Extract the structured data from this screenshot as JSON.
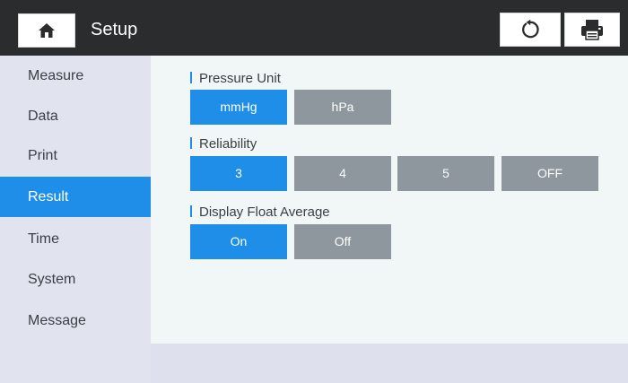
{
  "header": {
    "title": "Setup"
  },
  "sidebar": {
    "items": [
      {
        "label": "Measure"
      },
      {
        "label": "Data"
      },
      {
        "label": "Print"
      },
      {
        "label": "Result"
      },
      {
        "label": "Time"
      },
      {
        "label": "System"
      },
      {
        "label": "Message"
      }
    ],
    "active": "Result"
  },
  "settings": {
    "pressure_unit": {
      "title": "Pressure Unit",
      "options": [
        "mmHg",
        "hPa"
      ],
      "selected": "mmHg"
    },
    "reliability": {
      "title": "Reliability",
      "options": [
        "3",
        "4",
        "5",
        "OFF"
      ],
      "selected": "3"
    },
    "display_float_average": {
      "title": "Display Float Average",
      "options": [
        "On",
        "Off"
      ],
      "selected": "On"
    }
  },
  "colors": {
    "accent": "#1e8ee8",
    "unselected": "#8d979d",
    "topbar": "#2b2c2d",
    "sidebar": "#e1e3ef",
    "panel": "#f1f7f7"
  },
  "icons": {
    "home": "home-icon",
    "refresh": "refresh-icon",
    "print": "printer-icon"
  }
}
